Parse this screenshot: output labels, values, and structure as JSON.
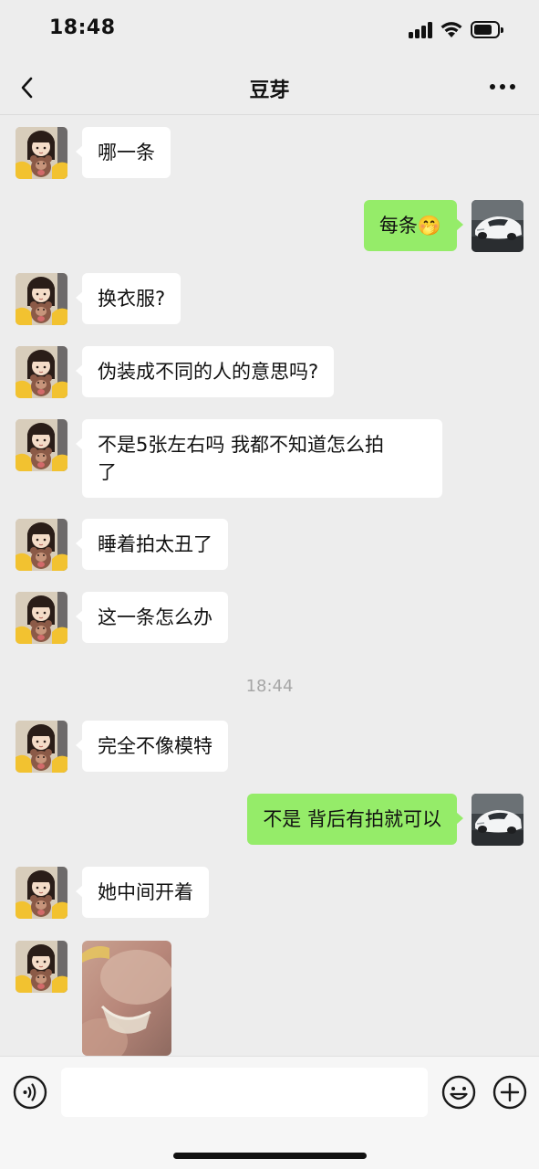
{
  "status_bar": {
    "time": "18:48"
  },
  "header": {
    "title": "豆芽"
  },
  "conversation": {
    "messages": [
      {
        "side": "in",
        "text": "哪一条"
      },
      {
        "side": "out",
        "text": "每条🤭"
      },
      {
        "side": "in",
        "text": "换衣服?"
      },
      {
        "side": "in",
        "text": "伪装成不同的人的意思吗?"
      },
      {
        "side": "in",
        "text": "不是5张左右吗 我都不知道怎么拍\n了"
      },
      {
        "side": "in",
        "text": "睡着拍太丑了"
      },
      {
        "side": "in",
        "text": "这一条怎么办"
      },
      {
        "side": "in",
        "text": "完全不像模特"
      },
      {
        "side": "out",
        "text": "不是 背后有拍就可以"
      },
      {
        "side": "in",
        "text": "她中间开着"
      }
    ],
    "timestamp": "18:44",
    "last_message": {
      "side": "in",
      "type": "image"
    }
  },
  "input_bar": {
    "value": ""
  },
  "icons": {
    "back": "chevron-left-icon",
    "more": "more-dots-icon",
    "voice": "voice-icon",
    "emoji": "emoji-icon",
    "plus": "plus-icon"
  },
  "colors": {
    "background": "#ededed",
    "incoming_bubble": "#ffffff",
    "outgoing_bubble": "#95ec69",
    "timestamp": "#a6a6a6"
  }
}
